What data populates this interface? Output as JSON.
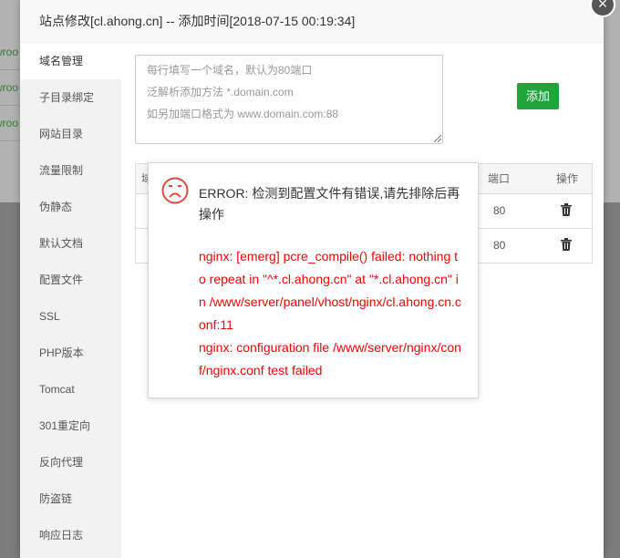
{
  "background": {
    "rows": [
      "wroo",
      "wroo",
      "wroo"
    ]
  },
  "modal": {
    "title": "站点修改[cl.ahong.cn] -- 添加时间[2018-07-15 00:19:34]",
    "close_glyph": "×"
  },
  "sidebar": {
    "items": [
      {
        "label": "域名管理"
      },
      {
        "label": "子目录绑定"
      },
      {
        "label": "网站目录"
      },
      {
        "label": "流量限制"
      },
      {
        "label": "伪静态"
      },
      {
        "label": "默认文档"
      },
      {
        "label": "配置文件"
      },
      {
        "label": "SSL"
      },
      {
        "label": "PHP版本"
      },
      {
        "label": "Tomcat"
      },
      {
        "label": "301重定向"
      },
      {
        "label": "反向代理"
      },
      {
        "label": "防盗链"
      },
      {
        "label": "响应日志"
      }
    ]
  },
  "domain": {
    "placeholder_lines": [
      "每行填写一个域名，默认为80端口",
      "泛解析添加方法 *.domain.com",
      "如另加端口格式为 www.domain.com:88"
    ],
    "add_label": "添加"
  },
  "table": {
    "col_domain_fragment": "域",
    "col_port": "端口",
    "col_op": "操作",
    "rows": [
      {
        "port": "80"
      },
      {
        "port": "80"
      }
    ]
  },
  "error": {
    "title": "ERROR: 检测到配置文件有错误,请先排除后再操作",
    "line1": "nginx: [emerg] pcre_compile() failed: nothing to repeat in \"^*.cl.ahong.cn\" at \"*.cl.ahong.cn\" in /www/server/panel/vhost/nginx/cl.ahong.cn.conf:11",
    "line2": "nginx: configuration file /www/server/nginx/conf/nginx.conf test failed"
  },
  "colors": {
    "accent": "#20a53a",
    "error_text": "#ff0000",
    "error_icon": "#e0493b"
  }
}
